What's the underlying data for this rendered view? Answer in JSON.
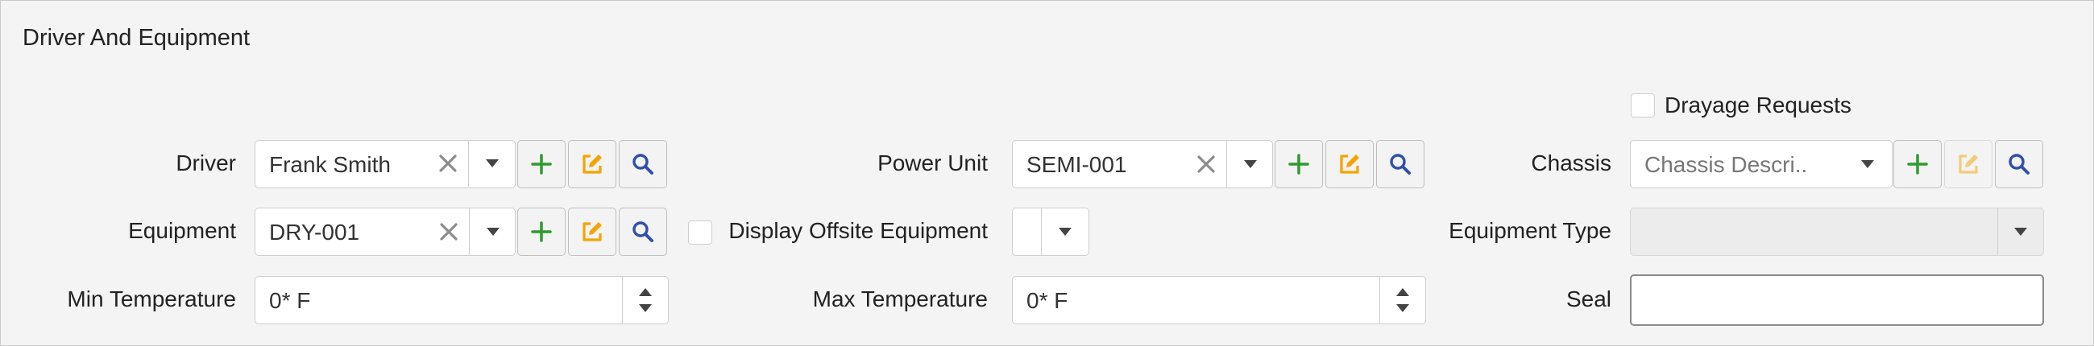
{
  "section": {
    "title": "Driver And Equipment"
  },
  "colors": {
    "add": "#2e9b2e",
    "edit": "#f5a300",
    "search": "#2f4fa8",
    "clear": "#8c8c8c"
  },
  "icons": {
    "add": "plus-icon",
    "edit": "edit-icon",
    "search": "search-icon",
    "clear": "close-icon",
    "dropdown": "chevron-down-icon",
    "spinner": "spinner-arrows-icon"
  },
  "driver": {
    "label": "Driver",
    "value": "Frank Smith"
  },
  "power_unit": {
    "label": "Power Unit",
    "value": "SEMI-001"
  },
  "drayage": {
    "label": "Drayage Requests",
    "checked": false
  },
  "chassis": {
    "label": "Chassis",
    "placeholder": "Chassis Descri..."
  },
  "equipment": {
    "label": "Equipment",
    "value": "DRY-001"
  },
  "offsite": {
    "label": "Display Offsite Equipment",
    "checked": false
  },
  "equipment_type": {
    "label": "Equipment Type",
    "value": ""
  },
  "min_temp": {
    "label": "Min Temperature",
    "value": "0* F"
  },
  "max_temp": {
    "label": "Max Temperature",
    "value": "0* F"
  },
  "seal": {
    "label": "Seal",
    "value": ""
  }
}
